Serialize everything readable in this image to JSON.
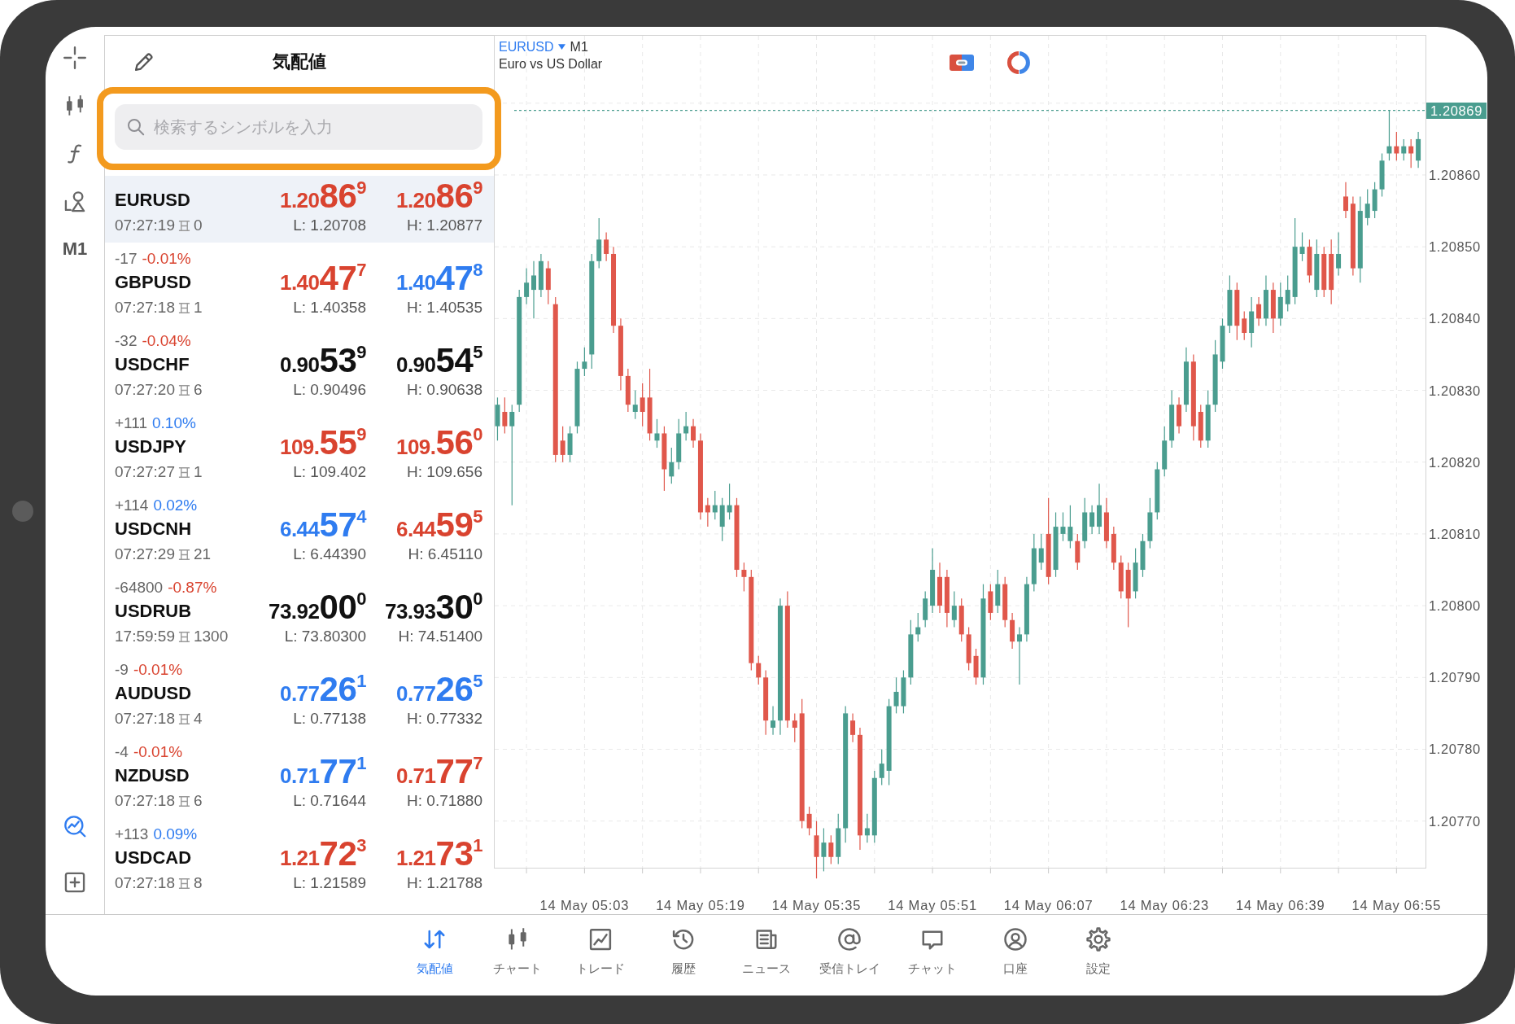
{
  "toolbar": {
    "timeframe": "M1"
  },
  "watchlist": {
    "title": "気配値",
    "search": {
      "placeholder": "検索するシンボルを入力"
    },
    "rows": [
      {
        "symbol": "EURUSD",
        "selected": true,
        "time": "07:27:19",
        "spread": "0",
        "bid": {
          "prefix": "1.20",
          "big": "86",
          "sup": "9",
          "color": "#d9432f"
        },
        "ask": {
          "prefix": "1.20",
          "big": "86",
          "sup": "9",
          "color": "#d9432f"
        },
        "low": "L: 1.20708",
        "high": "H: 1.20877"
      },
      {
        "symbol": "GBPUSD",
        "selected": false,
        "change": {
          "points": "-17",
          "percent": "-0.01%",
          "color": "#d9432f"
        },
        "time": "07:27:18",
        "spread": "1",
        "bid": {
          "prefix": "1.40",
          "big": "47",
          "sup": "7",
          "color": "#d9432f"
        },
        "ask": {
          "prefix": "1.40",
          "big": "47",
          "sup": "8",
          "color": "#2f7cf0"
        },
        "low": "L: 1.40358",
        "high": "H: 1.40535"
      },
      {
        "symbol": "USDCHF",
        "selected": false,
        "change": {
          "points": "-32",
          "percent": "-0.04%",
          "color": "#d9432f"
        },
        "time": "07:27:20",
        "spread": "6",
        "bid": {
          "prefix": "0.90",
          "big": "53",
          "sup": "9",
          "color": "#111111"
        },
        "ask": {
          "prefix": "0.90",
          "big": "54",
          "sup": "5",
          "color": "#111111"
        },
        "low": "L: 0.90496",
        "high": "H: 0.90638"
      },
      {
        "symbol": "USDJPY",
        "selected": false,
        "change": {
          "points": "+111",
          "percent": "0.10%",
          "color": "#2f7cf0"
        },
        "time": "07:27:27",
        "spread": "1",
        "bid": {
          "prefix": "109.",
          "big": "55",
          "sup": "9",
          "color": "#d9432f"
        },
        "ask": {
          "prefix": "109.",
          "big": "56",
          "sup": "0",
          "color": "#d9432f"
        },
        "low": "L: 109.402",
        "high": "H: 109.656"
      },
      {
        "symbol": "USDCNH",
        "selected": false,
        "change": {
          "points": "+114",
          "percent": "0.02%",
          "color": "#2f7cf0"
        },
        "time": "07:27:29",
        "spread": "21",
        "bid": {
          "prefix": "6.44",
          "big": "57",
          "sup": "4",
          "color": "#2f7cf0"
        },
        "ask": {
          "prefix": "6.44",
          "big": "59",
          "sup": "5",
          "color": "#d9432f"
        },
        "low": "L: 6.44390",
        "high": "H: 6.45110"
      },
      {
        "symbol": "USDRUB",
        "selected": false,
        "change": {
          "points": "-64800",
          "percent": "-0.87%",
          "color": "#d9432f"
        },
        "time": "17:59:59",
        "spread": "1300",
        "bid": {
          "prefix": "73.92",
          "big": "00",
          "sup": "0",
          "color": "#111111"
        },
        "ask": {
          "prefix": "73.93",
          "big": "30",
          "sup": "0",
          "color": "#111111"
        },
        "low": "L: 73.80300",
        "high": "H: 74.51400"
      },
      {
        "symbol": "AUDUSD",
        "selected": false,
        "change": {
          "points": "-9",
          "percent": "-0.01%",
          "color": "#d9432f"
        },
        "time": "07:27:18",
        "spread": "4",
        "bid": {
          "prefix": "0.77",
          "big": "26",
          "sup": "1",
          "color": "#2f7cf0"
        },
        "ask": {
          "prefix": "0.77",
          "big": "26",
          "sup": "5",
          "color": "#2f7cf0"
        },
        "low": "L: 0.77138",
        "high": "H: 0.77332"
      },
      {
        "symbol": "NZDUSD",
        "selected": false,
        "change": {
          "points": "-4",
          "percent": "-0.01%",
          "color": "#d9432f"
        },
        "time": "07:27:18",
        "spread": "6",
        "bid": {
          "prefix": "0.71",
          "big": "77",
          "sup": "1",
          "color": "#2f7cf0"
        },
        "ask": {
          "prefix": "0.71",
          "big": "77",
          "sup": "7",
          "color": "#d9432f"
        },
        "low": "L: 0.71644",
        "high": "H: 0.71880"
      },
      {
        "symbol": "USDCAD",
        "selected": false,
        "change": {
          "points": "+113",
          "percent": "0.09%",
          "color": "#2f7cf0"
        },
        "time": "07:27:18",
        "spread": "8",
        "bid": {
          "prefix": "1.21",
          "big": "72",
          "sup": "3",
          "color": "#d9432f"
        },
        "ask": {
          "prefix": "1.21",
          "big": "73",
          "sup": "1",
          "color": "#d9432f"
        },
        "low": "L: 1.21589",
        "high": "H: 1.21788"
      }
    ]
  },
  "chart": {
    "symbol": "EURUSD",
    "timeframe": "M1",
    "description": "Euro vs US Dollar",
    "chart_data": {
      "type": "candlestick",
      "grid": true,
      "categories": [
        null,
        null,
        null,
        null,
        null,
        null,
        null,
        null,
        null,
        null,
        null,
        null,
        "14 May 05:03",
        null,
        null,
        null,
        null,
        null,
        null,
        null,
        null,
        null,
        null,
        null,
        null,
        null,
        null,
        null,
        "14 May 05:19",
        null,
        null,
        null,
        null,
        null,
        null,
        null,
        null,
        null,
        null,
        null,
        null,
        null,
        null,
        null,
        "14 May 05:35",
        null,
        null,
        null,
        null,
        null,
        null,
        null,
        null,
        null,
        null,
        null,
        null,
        null,
        null,
        null,
        "14 May 05:51",
        null,
        null,
        null,
        null,
        null,
        null,
        null,
        null,
        null,
        null,
        null,
        null,
        null,
        null,
        null,
        "14 May 06:07",
        null,
        null,
        null,
        null,
        null,
        null,
        null,
        null,
        null,
        null,
        null,
        null,
        null,
        null,
        null,
        "14 May 06:23",
        null,
        null,
        null,
        null,
        null,
        null,
        null,
        null,
        null,
        null,
        null,
        null,
        null,
        null,
        null,
        "14 May 06:39",
        null,
        null,
        null,
        null,
        null,
        null,
        null,
        null,
        null,
        null,
        null,
        null,
        null,
        null,
        null,
        "14 May 06:55",
        null,
        null,
        null
      ],
      "ohlc": [
        [
          1.20825,
          1.20829,
          1.20823,
          1.20828
        ],
        [
          1.20827,
          1.20829,
          1.20824,
          1.20825
        ],
        [
          1.20825,
          1.20828,
          1.20814,
          1.20827
        ],
        [
          1.20828,
          1.20844,
          1.20827,
          1.20843
        ],
        [
          1.20843,
          1.20847,
          1.20842,
          1.20845
        ],
        [
          1.20844,
          1.20848,
          1.2084,
          1.20846
        ],
        [
          1.20844,
          1.20849,
          1.20843,
          1.20848
        ],
        [
          1.20847,
          1.20848,
          1.20842,
          1.20844
        ],
        [
          1.20842,
          1.20843,
          1.2082,
          1.20821
        ],
        [
          1.20823,
          1.20825,
          1.2082,
          1.20821
        ],
        [
          1.20821,
          1.20825,
          1.2082,
          1.20824
        ],
        [
          1.20825,
          1.20834,
          1.20824,
          1.20833
        ],
        [
          1.20833,
          1.20836,
          1.20832,
          1.20834
        ],
        [
          1.20835,
          1.20849,
          1.20833,
          1.20848
        ],
        [
          1.20848,
          1.20854,
          1.20847,
          1.20851
        ],
        [
          1.20851,
          1.20852,
          1.20848,
          1.20849
        ],
        [
          1.20849,
          1.2085,
          1.20838,
          1.20839
        ],
        [
          1.20839,
          1.2084,
          1.2083,
          1.20832
        ],
        [
          1.20832,
          1.20833,
          1.20827,
          1.20828
        ],
        [
          1.20827,
          1.2083,
          1.20826,
          1.20828
        ],
        [
          1.20829,
          1.20831,
          1.20825,
          1.20827
        ],
        [
          1.20829,
          1.20833,
          1.20823,
          1.20824
        ],
        [
          1.20823,
          1.20826,
          1.20822,
          1.20824
        ],
        [
          1.20824,
          1.20825,
          1.20816,
          1.20819
        ],
        [
          1.20818,
          1.20822,
          1.20817,
          1.2082
        ],
        [
          1.2082,
          1.20826,
          1.20819,
          1.20824
        ],
        [
          1.20824,
          1.20827,
          1.20823,
          1.20825
        ],
        [
          1.20825,
          1.20826,
          1.20822,
          1.20823
        ],
        [
          1.20823,
          1.20824,
          1.20812,
          1.20813
        ],
        [
          1.20814,
          1.20815,
          1.20811,
          1.20813
        ],
        [
          1.20813,
          1.20816,
          1.20812,
          1.20814
        ],
        [
          1.20811,
          1.20815,
          1.20809,
          1.20814
        ],
        [
          1.20813,
          1.20817,
          1.20812,
          1.20814
        ],
        [
          1.20814,
          1.20815,
          1.20804,
          1.20805
        ],
        [
          1.20805,
          1.20806,
          1.20802,
          1.20804
        ],
        [
          1.20804,
          1.20805,
          1.20791,
          1.20792
        ],
        [
          1.20792,
          1.20793,
          1.20789,
          1.2079
        ],
        [
          1.2079,
          1.20791,
          1.20782,
          1.20784
        ],
        [
          1.20783,
          1.20786,
          1.20782,
          1.20784
        ],
        [
          1.20784,
          1.20801,
          1.20782,
          1.208
        ],
        [
          1.208,
          1.20802,
          1.20783,
          1.20784
        ],
        [
          1.20784,
          1.20785,
          1.20781,
          1.20783
        ],
        [
          1.20785,
          1.20787,
          1.20769,
          1.2077
        ],
        [
          1.20771,
          1.20772,
          1.20768,
          1.20769
        ],
        [
          1.20768,
          1.2077,
          1.20762,
          1.20765
        ],
        [
          1.20765,
          1.20769,
          1.20763,
          1.20767
        ],
        [
          1.20767,
          1.20768,
          1.20764,
          1.20765
        ],
        [
          1.20765,
          1.20771,
          1.20764,
          1.20769
        ],
        [
          1.20769,
          1.20786,
          1.20767,
          1.20785
        ],
        [
          1.20784,
          1.20785,
          1.20781,
          1.20782
        ],
        [
          1.20782,
          1.20783,
          1.20766,
          1.20768
        ],
        [
          1.20768,
          1.20771,
          1.20767,
          1.20769
        ],
        [
          1.20768,
          1.20777,
          1.20767,
          1.20776
        ],
        [
          1.20776,
          1.2078,
          1.20775,
          1.20778
        ],
        [
          1.20777,
          1.20787,
          1.20775,
          1.20786
        ],
        [
          1.20786,
          1.2079,
          1.20785,
          1.20788
        ],
        [
          1.20786,
          1.20791,
          1.20785,
          1.2079
        ],
        [
          1.2079,
          1.20798,
          1.20789,
          1.20796
        ],
        [
          1.20796,
          1.20799,
          1.20795,
          1.20797
        ],
        [
          1.20798,
          1.20802,
          1.20797,
          1.20801
        ],
        [
          1.208,
          1.20808,
          1.20799,
          1.20805
        ],
        [
          1.20804,
          1.20806,
          1.20799,
          1.208
        ],
        [
          1.20804,
          1.20805,
          1.20797,
          1.20799
        ],
        [
          1.20798,
          1.20802,
          1.20797,
          1.208
        ],
        [
          1.208,
          1.20801,
          1.20795,
          1.20796
        ],
        [
          1.20796,
          1.20797,
          1.20791,
          1.20792
        ],
        [
          1.20793,
          1.20794,
          1.20789,
          1.2079
        ],
        [
          1.2079,
          1.20803,
          1.20789,
          1.20801
        ],
        [
          1.20802,
          1.20803,
          1.20798,
          1.20799
        ],
        [
          1.208,
          1.20805,
          1.20799,
          1.20803
        ],
        [
          1.20803,
          1.20804,
          1.20797,
          1.20798
        ],
        [
          1.20798,
          1.20799,
          1.20794,
          1.20795
        ],
        [
          1.20795,
          1.20797,
          1.20789,
          1.20796
        ],
        [
          1.20796,
          1.20804,
          1.20795,
          1.20803
        ],
        [
          1.20803,
          1.2081,
          1.20802,
          1.20808
        ],
        [
          1.20806,
          1.2081,
          1.20805,
          1.20808
        ],
        [
          1.2081,
          1.20815,
          1.20803,
          1.20804
        ],
        [
          1.20805,
          1.20813,
          1.20804,
          1.20811
        ],
        [
          1.2081,
          1.20813,
          1.20809,
          1.20811
        ],
        [
          1.20809,
          1.20814,
          1.20808,
          1.20811
        ],
        [
          1.20809,
          1.2081,
          1.20805,
          1.20806
        ],
        [
          1.20809,
          1.20815,
          1.20808,
          1.20813
        ],
        [
          1.20811,
          1.20814,
          1.2081,
          1.20813
        ],
        [
          1.20811,
          1.20817,
          1.2081,
          1.20814
        ],
        [
          1.20813,
          1.20815,
          1.20808,
          1.20809
        ],
        [
          1.2081,
          1.20811,
          1.20805,
          1.20806
        ],
        [
          1.20806,
          1.20807,
          1.20801,
          1.20802
        ],
        [
          1.20805,
          1.20806,
          1.20797,
          1.20801
        ],
        [
          1.20802,
          1.20808,
          1.20801,
          1.20806
        ],
        [
          1.20805,
          1.2081,
          1.20804,
          1.20809
        ],
        [
          1.20809,
          1.20815,
          1.20808,
          1.20813
        ],
        [
          1.20813,
          1.2082,
          1.20812,
          1.20819
        ],
        [
          1.20819,
          1.20825,
          1.20818,
          1.20823
        ],
        [
          1.20823,
          1.2083,
          1.20822,
          1.20828
        ],
        [
          1.20828,
          1.20829,
          1.20824,
          1.20825
        ],
        [
          1.20828,
          1.20836,
          1.20827,
          1.20834
        ],
        [
          1.20834,
          1.20835,
          1.20823,
          1.20825
        ],
        [
          1.20827,
          1.20828,
          1.20822,
          1.20823
        ],
        [
          1.20823,
          1.2083,
          1.20822,
          1.20828
        ],
        [
          1.20828,
          1.20837,
          1.20827,
          1.20835
        ],
        [
          1.20834,
          1.2084,
          1.20833,
          1.20839
        ],
        [
          1.20839,
          1.20846,
          1.20838,
          1.20844
        ],
        [
          1.20844,
          1.20845,
          1.20837,
          1.20839
        ],
        [
          1.2084,
          1.20841,
          1.20837,
          1.20838
        ],
        [
          1.20838,
          1.20843,
          1.20836,
          1.20841
        ],
        [
          1.20842,
          1.20843,
          1.20839,
          1.2084
        ],
        [
          1.2084,
          1.20846,
          1.20839,
          1.20844
        ],
        [
          1.20844,
          1.20845,
          1.20838,
          1.2084
        ],
        [
          1.2084,
          1.20845,
          1.20839,
          1.20843
        ],
        [
          1.20842,
          1.20846,
          1.20841,
          1.20844
        ],
        [
          1.20843,
          1.20854,
          1.20842,
          1.2085
        ],
        [
          1.20849,
          1.20852,
          1.20848,
          1.2085
        ],
        [
          1.2085,
          1.20851,
          1.20845,
          1.20846
        ],
        [
          1.20844,
          1.20851,
          1.20843,
          1.20849
        ],
        [
          1.20849,
          1.2085,
          1.20843,
          1.20844
        ],
        [
          1.20849,
          1.20851,
          1.20842,
          1.20844
        ],
        [
          1.20847,
          1.20852,
          1.20846,
          1.20849
        ],
        [
          1.20857,
          1.20859,
          1.20854,
          1.20855
        ],
        [
          1.20856,
          1.20857,
          1.20846,
          1.20847
        ],
        [
          1.20847,
          1.20857,
          1.20845,
          1.20855
        ],
        [
          1.20854,
          1.20858,
          1.20853,
          1.20856
        ],
        [
          1.20855,
          1.20859,
          1.20854,
          1.20858
        ],
        [
          1.20858,
          1.20863,
          1.20857,
          1.20862
        ],
        [
          1.20863,
          1.20869,
          1.20862,
          1.20864
        ],
        [
          1.20864,
          1.20866,
          1.20862,
          1.20863
        ],
        [
          1.20863,
          1.20865,
          1.20862,
          1.20864
        ],
        [
          1.20864,
          1.20865,
          1.20861,
          1.20863
        ],
        [
          1.20862,
          1.20866,
          1.20861,
          1.20865
        ]
      ],
      "ylim": [
        1.207635,
        1.208795
      ],
      "yticks": [
        {
          "value": 1.2086,
          "label": "1.20860"
        },
        {
          "value": 1.2085,
          "label": "1.20850"
        },
        {
          "value": 1.2084,
          "label": "1.20840"
        },
        {
          "value": 1.2083,
          "label": "1.20830"
        },
        {
          "value": 1.2082,
          "label": "1.20820"
        },
        {
          "value": 1.2081,
          "label": "1.20810"
        },
        {
          "value": 1.208,
          "label": "1.20800"
        },
        {
          "value": 1.2079,
          "label": "1.20790"
        },
        {
          "value": 1.2078,
          "label": "1.20780"
        },
        {
          "value": 1.2077,
          "label": "1.20770"
        }
      ],
      "ref_lines": [
        {
          "axis": "y",
          "value": 1.20869,
          "label": "1.20869"
        }
      ]
    }
  },
  "bottom_nav": [
    {
      "label": "気配値",
      "selected": true
    },
    {
      "label": "チャート",
      "selected": false
    },
    {
      "label": "トレード",
      "selected": false
    },
    {
      "label": "履歴",
      "selected": false
    },
    {
      "label": "ニュース",
      "selected": false
    },
    {
      "label": "受信トレイ",
      "selected": false
    },
    {
      "label": "チャット",
      "selected": false
    },
    {
      "label": "口座",
      "selected": false
    },
    {
      "label": "設定",
      "selected": false
    }
  ]
}
